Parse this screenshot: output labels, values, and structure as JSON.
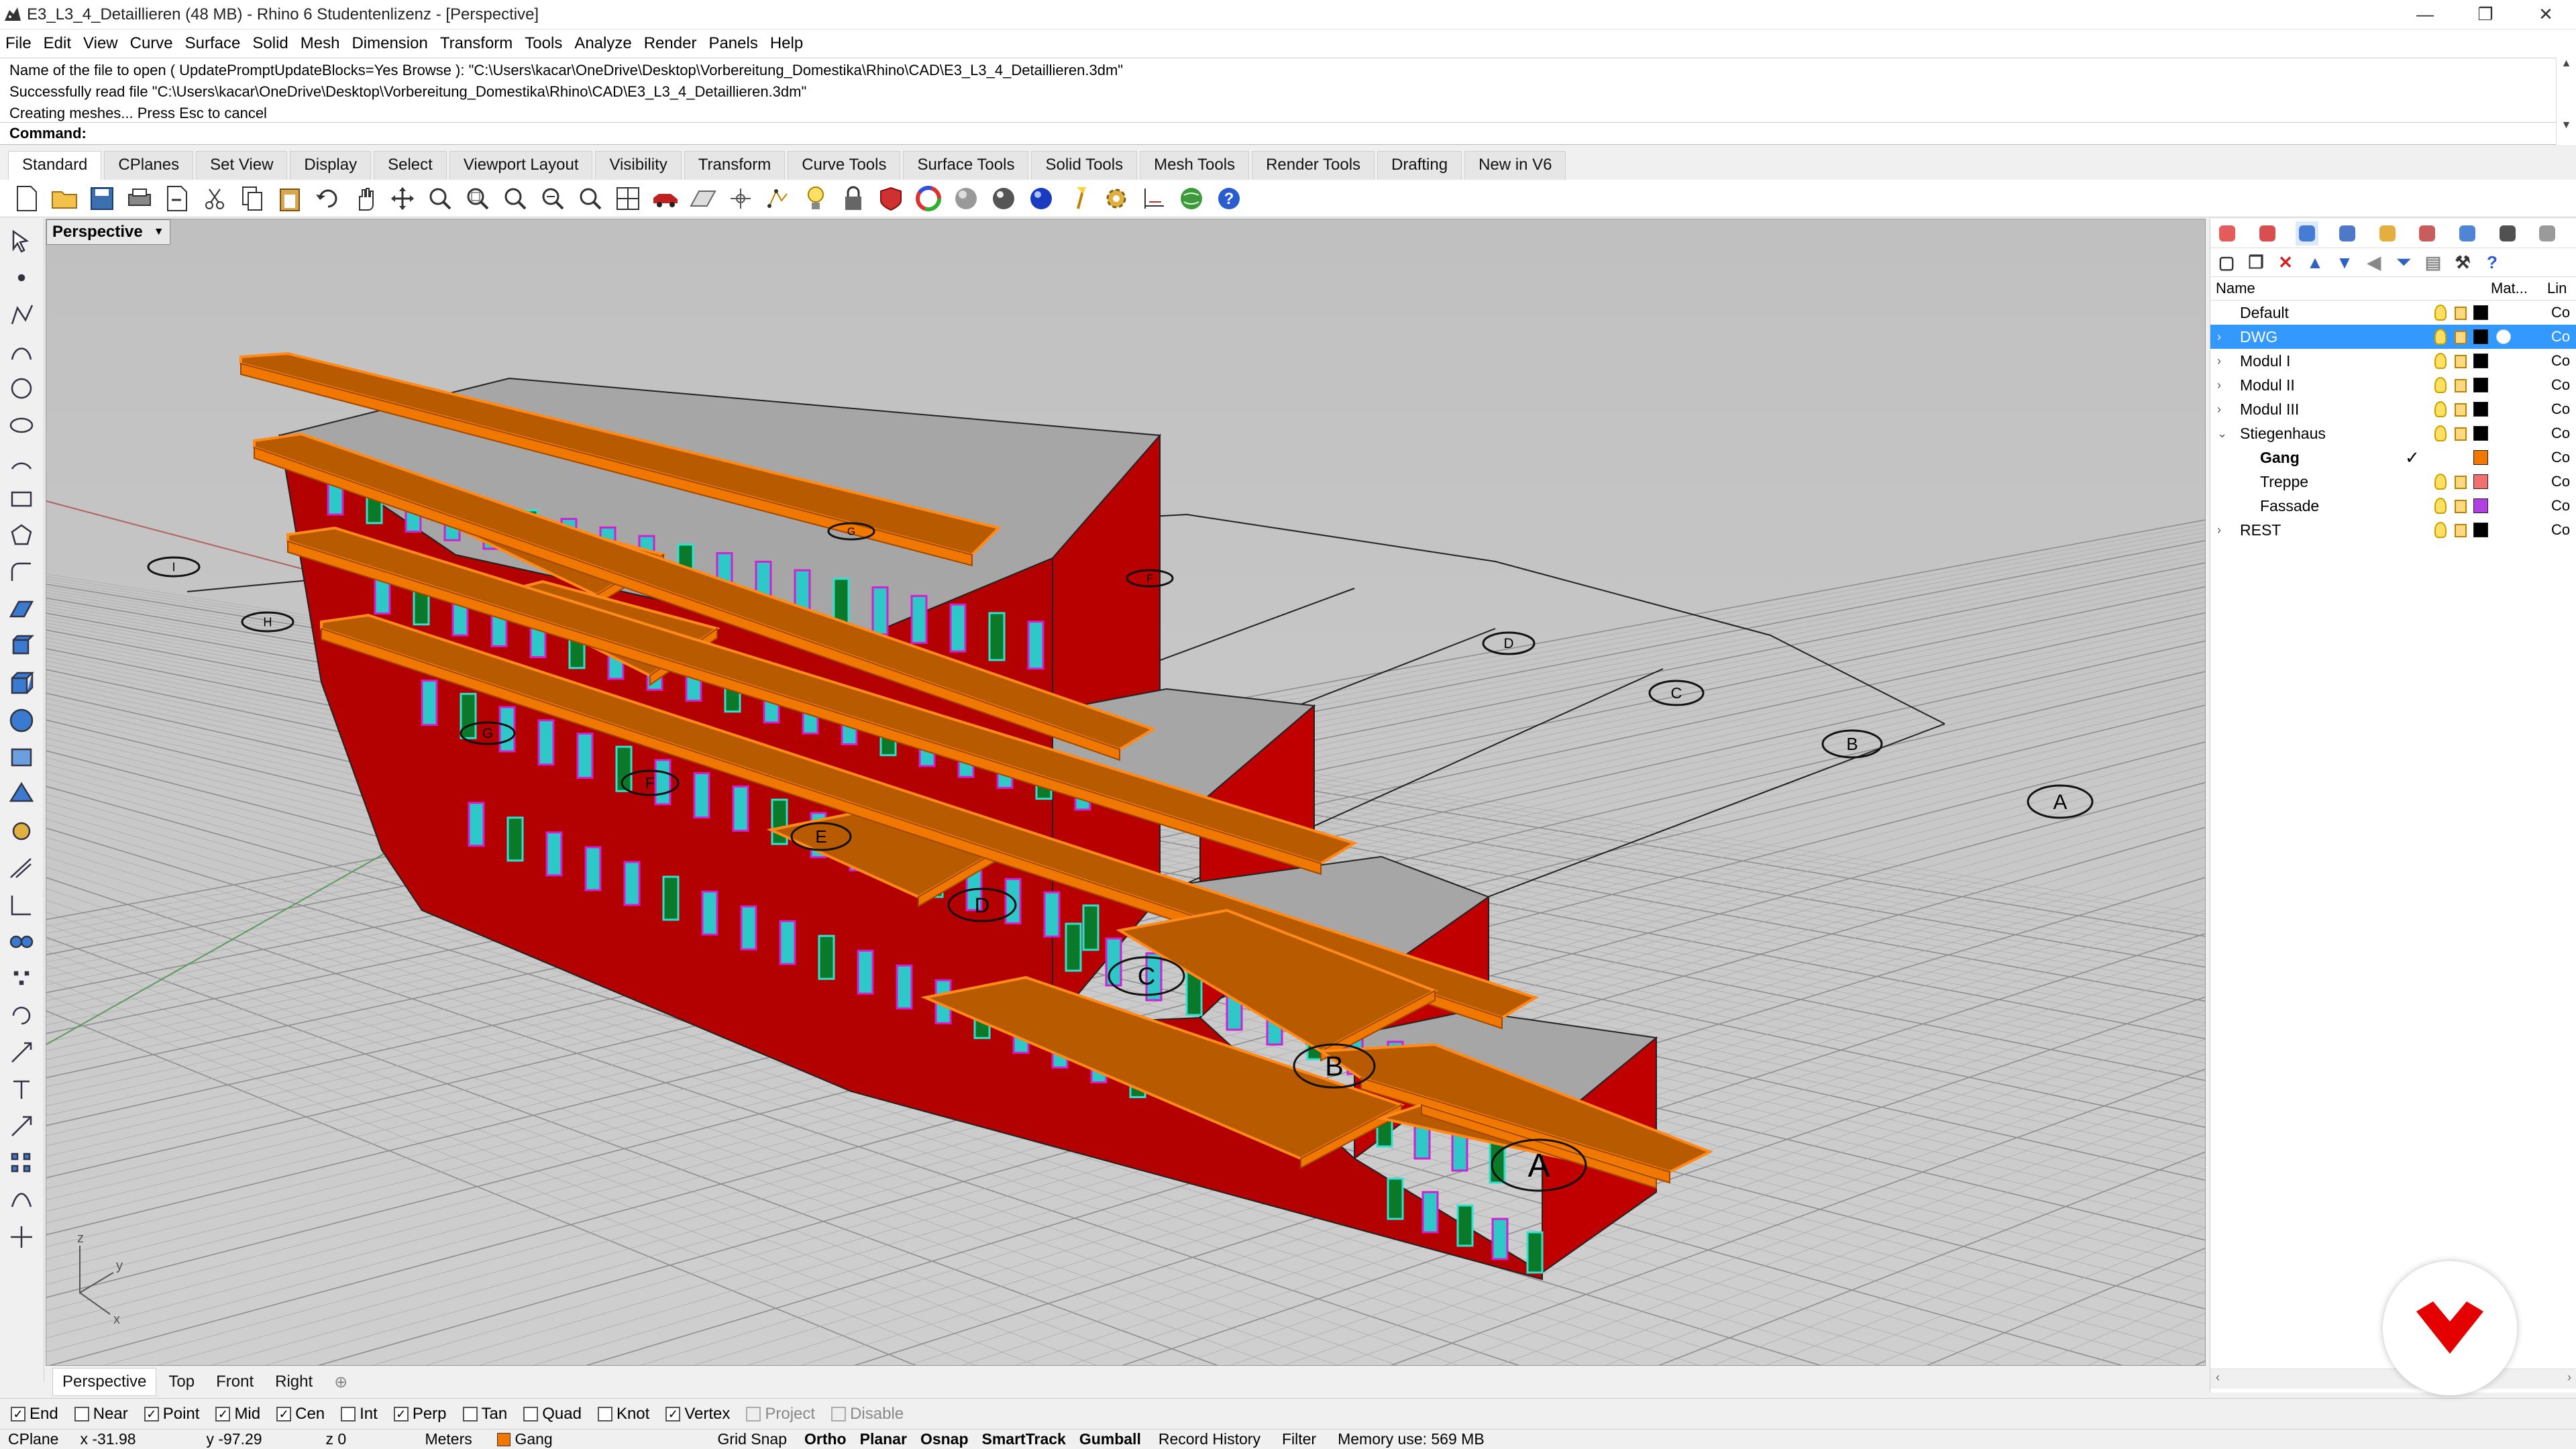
{
  "window": {
    "title": "E3_L3_4_Detaillieren (48 MB) - Rhino 6 Studentenlizenz - [Perspective]",
    "minimize_icon": "minimize-icon",
    "maximize_icon": "restore-icon",
    "close_icon": "close-icon"
  },
  "menu": [
    "File",
    "Edit",
    "View",
    "Curve",
    "Surface",
    "Solid",
    "Mesh",
    "Dimension",
    "Transform",
    "Tools",
    "Analyze",
    "Render",
    "Panels",
    "Help"
  ],
  "command_history": [
    "Name of the file to open ( UpdatePromptUpdateBlocks=Yes  Browse ): \"C:\\Users\\kacar\\OneDrive\\Desktop\\Vorbereitung_Domestika\\Rhino\\CAD\\E3_L3_4_Detaillieren.3dm\"",
    "Successfully read file \"C:\\Users\\kacar\\OneDrive\\Desktop\\Vorbereitung_Domestika\\Rhino\\CAD\\E3_L3_4_Detaillieren.3dm\"",
    "Creating meshes... Press Esc to cancel"
  ],
  "command_prompt": "Command:",
  "toolbar_tabs": [
    "Standard",
    "CPlanes",
    "Set View",
    "Display",
    "Select",
    "Viewport Layout",
    "Visibility",
    "Transform",
    "Curve Tools",
    "Surface Tools",
    "Solid Tools",
    "Mesh Tools",
    "Render Tools",
    "Drafting",
    "New in V6"
  ],
  "active_tab": "Standard",
  "standard_tools": [
    "new-icon",
    "open-icon",
    "save-icon",
    "print-icon",
    "import-icon",
    "cut-icon",
    "copy-icon",
    "paste-icon",
    "undo-icon",
    "pan-icon",
    "rotate-view-icon",
    "zoom-icon",
    "zoom-window-icon",
    "zoom-extents-icon",
    "zoom-selected-icon",
    "zoom-dynamic-icon",
    "four-viewports-icon",
    "car-icon",
    "cplane-icon",
    "grid-snap-icon",
    "points-icon",
    "lights-icon",
    "lock-icon",
    "material-icon",
    "color-wheel-icon",
    "shaded-sphere-icon",
    "rendered-sphere-icon",
    "blue-sphere-icon",
    "spotlight-icon",
    "options-icon",
    "dimension-icon",
    "globe-icon",
    "help-icon"
  ],
  "left_tools": [
    "select-arrow-icon",
    "point-icon",
    "polyline-icon",
    "curve-icon",
    "circle-icon",
    "ellipse-icon",
    "arc-icon",
    "rectangle-icon",
    "polygon-icon",
    "fillet-icon",
    "surface-icon",
    "extrude-icon",
    "box-icon",
    "sphere-icon",
    "cylinder-icon",
    "mesh-icon",
    "gear-icon",
    "light-icon",
    "dimension-icon",
    "boolean-icon",
    "point-cloud-icon",
    "rotate-icon",
    "scale-icon",
    "text-icon",
    "move-icon",
    "array-icon",
    "edit-points-icon",
    "transform-icon"
  ],
  "viewport": {
    "label": "Perspective",
    "dropdown_icon": "viewport-menu-icon",
    "axis_labels": {
      "z": "z",
      "y": "y",
      "x": "x"
    },
    "grid_labels_back": [
      "I",
      "H",
      "G",
      "F",
      "D",
      "C",
      "B",
      "A"
    ],
    "grid_labels_front": [
      "G",
      "F",
      "E",
      "D",
      "C",
      "B",
      "A"
    ]
  },
  "view_tabs": [
    "Perspective",
    "Top",
    "Front",
    "Right"
  ],
  "active_view_tab": "Perspective",
  "add_view_icon": "add-view-icon",
  "osnaps": [
    {
      "label": "End",
      "checked": true
    },
    {
      "label": "Near",
      "checked": false
    },
    {
      "label": "Point",
      "checked": true
    },
    {
      "label": "Mid",
      "checked": true
    },
    {
      "label": "Cen",
      "checked": true
    },
    {
      "label": "Int",
      "checked": false
    },
    {
      "label": "Perp",
      "checked": true
    },
    {
      "label": "Tan",
      "checked": false
    },
    {
      "label": "Quad",
      "checked": false
    },
    {
      "label": "Knot",
      "checked": false
    },
    {
      "label": "Vertex",
      "checked": true
    },
    {
      "label": "Project",
      "checked": false,
      "disabled": true
    },
    {
      "label": "Disable",
      "checked": false,
      "disabled": true
    }
  ],
  "status": {
    "cplane": "CPlane",
    "x": "x -31.98",
    "y": "y -97.29",
    "z": "z 0",
    "units": "Meters",
    "layer": "Gang",
    "layer_color": "#f07800",
    "grid_snap": "Grid Snap",
    "ortho": "Ortho",
    "planar": "Planar",
    "osnap": "Osnap",
    "smarttrack": "SmartTrack",
    "gumball": "Gumball",
    "record_history": "Record History",
    "filter": "Filter",
    "memory": "Memory use: 569 MB"
  },
  "panel": {
    "tab_icons": [
      "display-color-icon",
      "materials-icon",
      "layers-icon",
      "properties-icon",
      "libraries-icon",
      "environment-icon",
      "render-icon",
      "camera-icon",
      "settings-icon"
    ],
    "layer_tools": [
      "new-layer-icon",
      "new-sublayer-icon",
      "delete-icon",
      "move-up-icon",
      "move-down-icon",
      "move-left-icon",
      "filter-icon",
      "layer-states-icon",
      "tools-icon",
      "help-icon"
    ],
    "columns": {
      "name": "Name",
      "material": "Mat...",
      "linetype": "Lin"
    },
    "layers": [
      {
        "name": "Default",
        "expand": "",
        "color": "#000000",
        "linetype": "Co",
        "selected": false,
        "child": false
      },
      {
        "name": "DWG",
        "expand": "›",
        "color": "#000000",
        "linetype": "Co",
        "selected": true,
        "child": false
      },
      {
        "name": "Modul I",
        "expand": "›",
        "color": "#000000",
        "linetype": "Co",
        "selected": false,
        "child": false
      },
      {
        "name": "Modul II",
        "expand": "›",
        "color": "#000000",
        "linetype": "Co",
        "selected": false,
        "child": false
      },
      {
        "name": "Modul III",
        "expand": "›",
        "color": "#000000",
        "linetype": "Co",
        "selected": false,
        "child": false
      },
      {
        "name": "Stiegenhaus",
        "expand": "⌄",
        "color": "#000000",
        "linetype": "Co",
        "selected": false,
        "child": false
      },
      {
        "name": "Gang",
        "expand": "",
        "color": "#f07800",
        "linetype": "Co",
        "selected": false,
        "child": true,
        "current": true
      },
      {
        "name": "Treppe",
        "expand": "",
        "color": "#f07070",
        "linetype": "Co",
        "selected": false,
        "child": true
      },
      {
        "name": "Fassade",
        "expand": "",
        "color": "#b040e0",
        "linetype": "Co",
        "selected": false,
        "child": true
      },
      {
        "name": "REST",
        "expand": "›",
        "color": "#000000",
        "linetype": "Co",
        "selected": false,
        "child": false
      }
    ]
  },
  "badge_icon": "domestika-logo-icon"
}
